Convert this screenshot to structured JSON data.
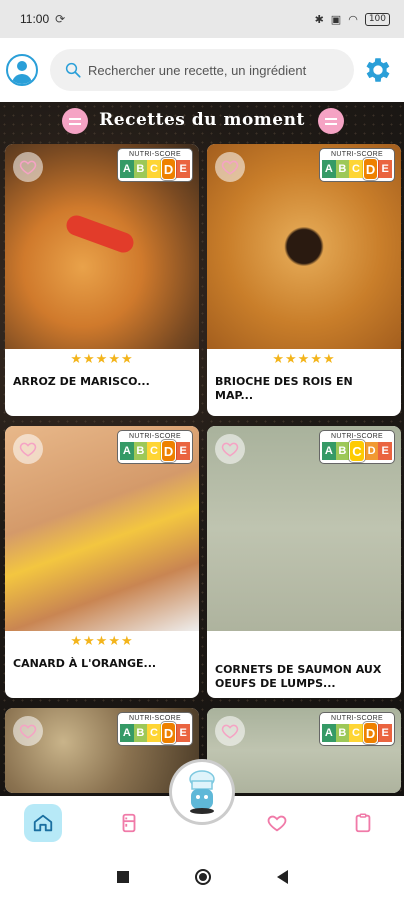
{
  "status_bar": {
    "time": "11:00",
    "battery": "100"
  },
  "search": {
    "placeholder": "Rechercher une recette, un ingrédient"
  },
  "section": {
    "title": "Recettes du moment"
  },
  "nutri_label": "NUTRI-SCORE",
  "nutri_letters": [
    "A",
    "B",
    "C",
    "D",
    "E"
  ],
  "recipes": [
    {
      "title": "ARROZ DE MARISCO...",
      "stars": "★★★★★",
      "rating": 4.5,
      "nutri_score": "D"
    },
    {
      "title": "BRIOCHE DES ROIS EN MAP...",
      "stars": "★★★★★",
      "rating": 4.5,
      "nutri_score": "D"
    },
    {
      "title": "CANARD À L'ORANGE...",
      "stars": "★★★★★",
      "rating": 5,
      "nutri_score": "D"
    },
    {
      "title": "CORNETS DE SAUMON AUX OEUFS DE LUMPS...",
      "stars": "",
      "rating": null,
      "nutri_score": "C"
    },
    {
      "title": "",
      "stars": "",
      "rating": null,
      "nutri_score": "D"
    },
    {
      "title": "",
      "stars": "",
      "rating": null,
      "nutri_score": "D"
    }
  ],
  "colors": {
    "accent_blue": "#2a9fd8",
    "accent_pink": "#f5a3c4",
    "star": "#f3b41b"
  },
  "icons": {
    "header": [
      "user-avatar-icon",
      "search-icon",
      "gear-icon"
    ],
    "bottom_nav": [
      "home-icon",
      "fridge-icon",
      "heart-icon",
      "notepad-icon"
    ]
  }
}
